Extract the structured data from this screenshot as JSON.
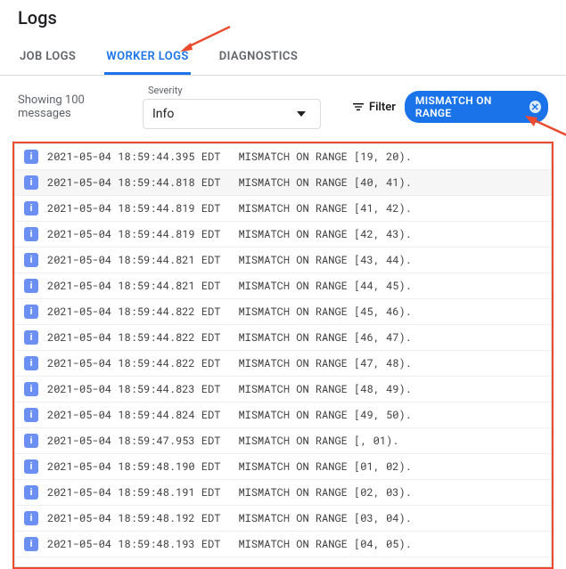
{
  "title": "Logs",
  "tabs": {
    "job": "JOB LOGS",
    "worker": "WORKER LOGS",
    "diag": "DIAGNOSTICS",
    "active": "worker"
  },
  "controls": {
    "showing": "Showing 100 messages",
    "severity_label": "Severity",
    "severity_value": "Info",
    "filter_label": "Filter",
    "chip_label": "MISMATCH ON RANGE"
  },
  "rows": [
    {
      "alt": false,
      "ts": "2021-05-04 18:59:44.395 EDT",
      "msg": "MISMATCH ON RANGE [19, 20)."
    },
    {
      "alt": true,
      "ts": "2021-05-04 18:59:44.818 EDT",
      "msg": "MISMATCH ON RANGE [40, 41)."
    },
    {
      "alt": false,
      "ts": "2021-05-04 18:59:44.819 EDT",
      "msg": "MISMATCH ON RANGE [41, 42)."
    },
    {
      "alt": false,
      "ts": "2021-05-04 18:59:44.819 EDT",
      "msg": "MISMATCH ON RANGE [42, 43)."
    },
    {
      "alt": false,
      "ts": "2021-05-04 18:59:44.821 EDT",
      "msg": "MISMATCH ON RANGE [43, 44)."
    },
    {
      "alt": false,
      "ts": "2021-05-04 18:59:44.821 EDT",
      "msg": "MISMATCH ON RANGE [44, 45)."
    },
    {
      "alt": false,
      "ts": "2021-05-04 18:59:44.822 EDT",
      "msg": "MISMATCH ON RANGE [45, 46)."
    },
    {
      "alt": false,
      "ts": "2021-05-04 18:59:44.822 EDT",
      "msg": "MISMATCH ON RANGE [46, 47)."
    },
    {
      "alt": false,
      "ts": "2021-05-04 18:59:44.822 EDT",
      "msg": "MISMATCH ON RANGE [47, 48)."
    },
    {
      "alt": false,
      "ts": "2021-05-04 18:59:44.823 EDT",
      "msg": "MISMATCH ON RANGE [48, 49)."
    },
    {
      "alt": false,
      "ts": "2021-05-04 18:59:44.824 EDT",
      "msg": "MISMATCH ON RANGE [49, 50)."
    },
    {
      "alt": false,
      "ts": "2021-05-04 18:59:47.953 EDT",
      "msg": "MISMATCH ON RANGE [, 01)."
    },
    {
      "alt": false,
      "ts": "2021-05-04 18:59:48.190 EDT",
      "msg": "MISMATCH ON RANGE [01, 02)."
    },
    {
      "alt": false,
      "ts": "2021-05-04 18:59:48.191 EDT",
      "msg": "MISMATCH ON RANGE [02, 03)."
    },
    {
      "alt": false,
      "ts": "2021-05-04 18:59:48.192 EDT",
      "msg": "MISMATCH ON RANGE [03, 04)."
    },
    {
      "alt": false,
      "ts": "2021-05-04 18:59:48.193 EDT",
      "msg": "MISMATCH ON RANGE [04, 05)."
    }
  ]
}
